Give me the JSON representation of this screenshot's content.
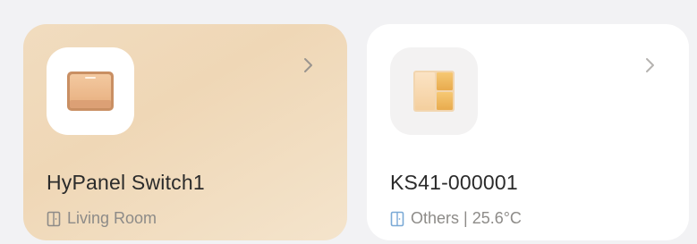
{
  "devices": [
    {
      "name": "HyPanel Switch1",
      "room": "Living Room",
      "icon": "wall-switch-icon",
      "room_icon_color": "#8d8b88"
    },
    {
      "name": "KS41-000001",
      "room": "Others | 25.6°C",
      "icon": "dual-panel-switch-icon",
      "room_icon_color": "#7aa9d6"
    }
  ],
  "colors": {
    "card_warm_bg": "#efd7b6",
    "card_white_bg": "#ffffff",
    "page_bg": "#f2f2f4"
  }
}
